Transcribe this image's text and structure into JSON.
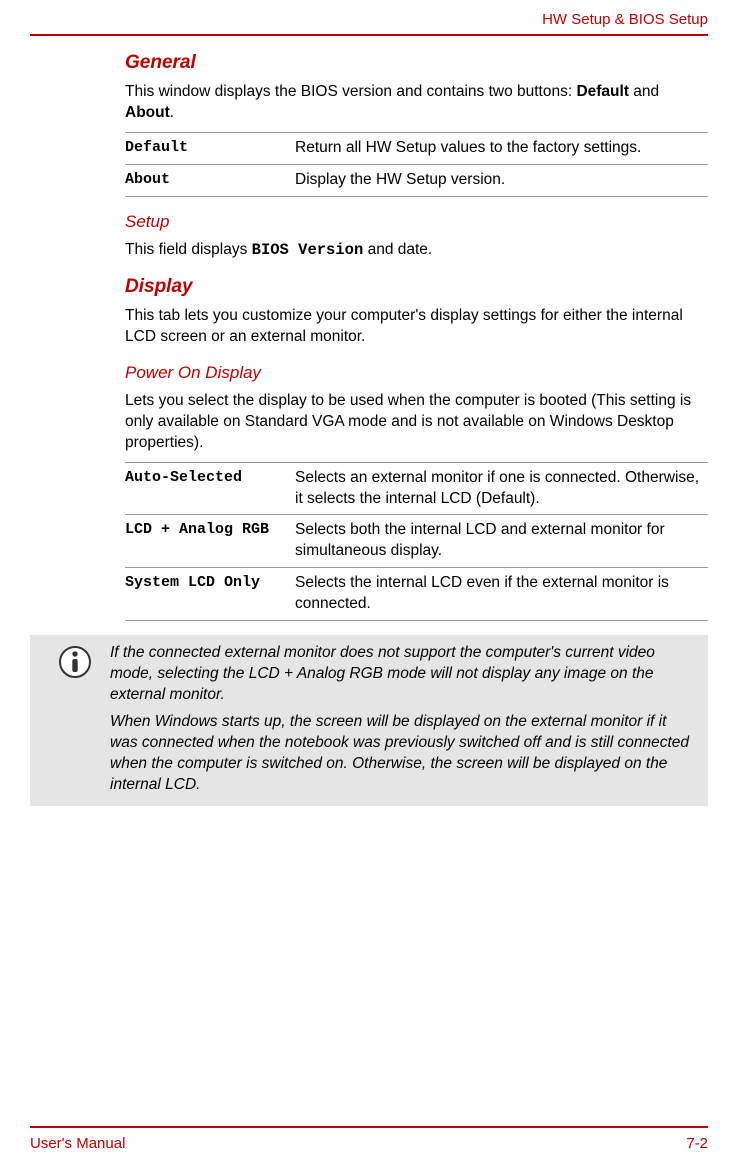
{
  "header": {
    "title": "HW Setup & BIOS Setup"
  },
  "sections": {
    "general": {
      "heading": "General",
      "intro_before": "This window displays the BIOS version and contains two buttons: ",
      "bold1": "Default",
      "intro_mid": " and ",
      "bold2": "About",
      "intro_after": ".",
      "rows": [
        {
          "term": "Default",
          "desc": "Return all HW Setup values to the factory settings."
        },
        {
          "term": "About",
          "desc": "Display the HW Setup version."
        }
      ]
    },
    "setup": {
      "heading": "Setup",
      "text_before": "This field displays ",
      "mono": "BIOS Version",
      "text_after": " and date."
    },
    "display": {
      "heading": "Display",
      "text": "This tab lets you customize your computer's display settings for either the internal LCD screen or an external monitor."
    },
    "poweron": {
      "heading": "Power On Display",
      "text": "Lets you select the display to be used when the computer is booted (This setting is only available on Standard VGA mode and is not available on Windows Desktop properties).",
      "rows": [
        {
          "term": "Auto-Selected",
          "desc": "Selects an external monitor if one is connected. Otherwise, it selects the internal LCD (Default)."
        },
        {
          "term": "LCD + Analog RGB",
          "desc": "Selects both the internal LCD and external monitor for simultaneous display."
        },
        {
          "term": "System LCD Only",
          "desc": "Selects the internal LCD even if the external monitor is connected."
        }
      ]
    },
    "note": {
      "p1": "If the connected external monitor does not support the computer's current video mode, selecting the LCD + Analog RGB mode will not display any image on the external monitor.",
      "p2": "When Windows starts up, the screen will be displayed on the external monitor if it was connected when the notebook was previously switched off and is still connected when the computer is switched on. Otherwise, the screen will be displayed on the internal LCD."
    }
  },
  "footer": {
    "left": "User's Manual",
    "right": "7-2"
  }
}
